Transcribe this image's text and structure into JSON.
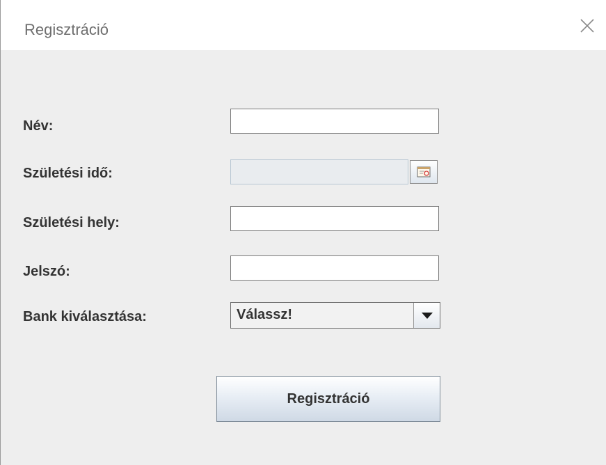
{
  "window": {
    "title": "Regisztráció"
  },
  "form": {
    "name_label": "Név:",
    "name_value": "",
    "birth_date_label": "Születési idő:",
    "birth_date_value": "",
    "birth_place_label": "Születési hely:",
    "birth_place_value": "",
    "password_label": "Jelszó:",
    "password_value": "",
    "bank_label": "Bank kiválasztása:",
    "bank_selected": "Válassz!"
  },
  "actions": {
    "submit_label": "Regisztráció"
  },
  "icons": {
    "close": "close-icon",
    "calendar": "calendar-icon",
    "dropdown": "chevron-down-icon"
  },
  "colors": {
    "window_bg": "#eeeeee",
    "titlebar_bg": "#ffffff",
    "text": "#333333"
  }
}
